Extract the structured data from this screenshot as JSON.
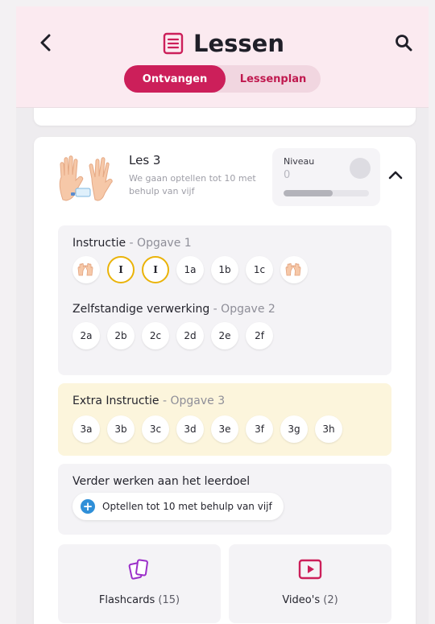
{
  "header": {
    "title": "Lessen",
    "tabs": {
      "active": "Ontvangen",
      "inactive": "Lessenplan"
    }
  },
  "lesson": {
    "title": "Les 3",
    "subtitle": "We gaan optellen tot 10 met behulp van vijf",
    "niveau": {
      "label": "Niveau",
      "value": "0",
      "progress_fraction": 0.58
    },
    "sections": {
      "instructie": {
        "title": "Instructie",
        "suffix": " - Opgave 1",
        "chips": [
          "hands",
          "I",
          "I",
          "1a",
          "1b",
          "1c",
          "hands"
        ]
      },
      "zelfstandig": {
        "title": "Zelfstandige verwerking",
        "suffix": " - Opgave 2",
        "chips": [
          "2a",
          "2b",
          "2c",
          "2d",
          "2e",
          "2f"
        ]
      },
      "extra": {
        "title": "Extra Instructie",
        "suffix": " - Opgave 3",
        "chips": [
          "3a",
          "3b",
          "3c",
          "3d",
          "3e",
          "3f",
          "3g",
          "3h"
        ]
      },
      "verder": {
        "title": "Verder werken aan het leerdoel",
        "goal": "Optellen tot 10 met behulp van vijf"
      }
    },
    "tiles": {
      "flashcards": {
        "label": "Flashcards",
        "count": "(15)"
      },
      "videos": {
        "label": "Video's",
        "count": "(2)"
      }
    }
  },
  "colors": {
    "accent": "#cc1f5a",
    "ring": "#eab308",
    "plus": "#2f8fd8",
    "header_bg": "#fbeaf0"
  },
  "icons": {
    "back": "chevron-left-icon",
    "title": "list-icon",
    "search": "search-icon",
    "collapse": "chevron-up-icon",
    "flashcards": "cards-icon",
    "videos": "video-play-icon"
  }
}
